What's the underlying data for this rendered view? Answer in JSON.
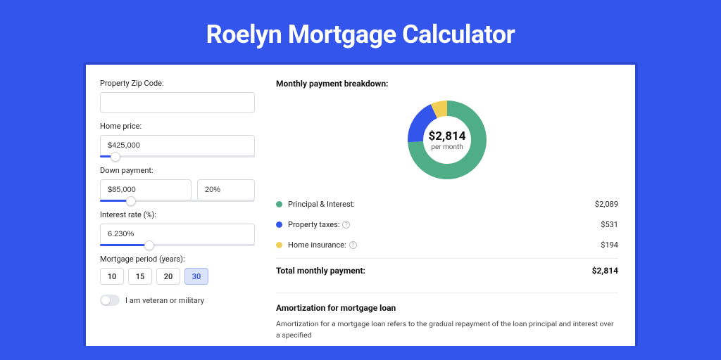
{
  "title": "Roelyn Mortgage Calculator",
  "form": {
    "zip_label": "Property Zip Code:",
    "zip_value": "",
    "home_price_label": "Home price:",
    "home_price_value": "$425,000",
    "down_payment_label": "Down payment:",
    "down_payment_value": "$85,000",
    "down_payment_pct": "20%",
    "interest_label": "Interest rate (%):",
    "interest_value": "6.230%",
    "period_label": "Mortgage period (years):",
    "periods": [
      "10",
      "15",
      "20",
      "30"
    ],
    "period_selected": "30",
    "veteran_label": "I am veteran or military"
  },
  "breakdown": {
    "title": "Monthly payment breakdown:",
    "center_value": "$2,814",
    "center_sub": "per month",
    "items": [
      {
        "label": "Principal & Interest:",
        "value": "$2,089",
        "color": "#4fae87",
        "pct": 74,
        "help": false
      },
      {
        "label": "Property taxes:",
        "value": "$531",
        "color": "#3455eb",
        "pct": 19,
        "help": true
      },
      {
        "label": "Home insurance:",
        "value": "$194",
        "color": "#f1cf56",
        "pct": 7,
        "help": true
      }
    ],
    "total_label": "Total monthly payment:",
    "total_value": "$2,814"
  },
  "amort": {
    "title": "Amortization for mortgage loan",
    "text": "Amortization for a mortgage loan refers to the gradual repayment of the loan principal and interest over a specified"
  },
  "chart_data": {
    "type": "pie",
    "title": "Monthly payment breakdown",
    "series": [
      {
        "name": "Principal & Interest",
        "value": 2089
      },
      {
        "name": "Property taxes",
        "value": 531
      },
      {
        "name": "Home insurance",
        "value": 194
      }
    ],
    "total": 2814,
    "unit": "USD/month"
  }
}
